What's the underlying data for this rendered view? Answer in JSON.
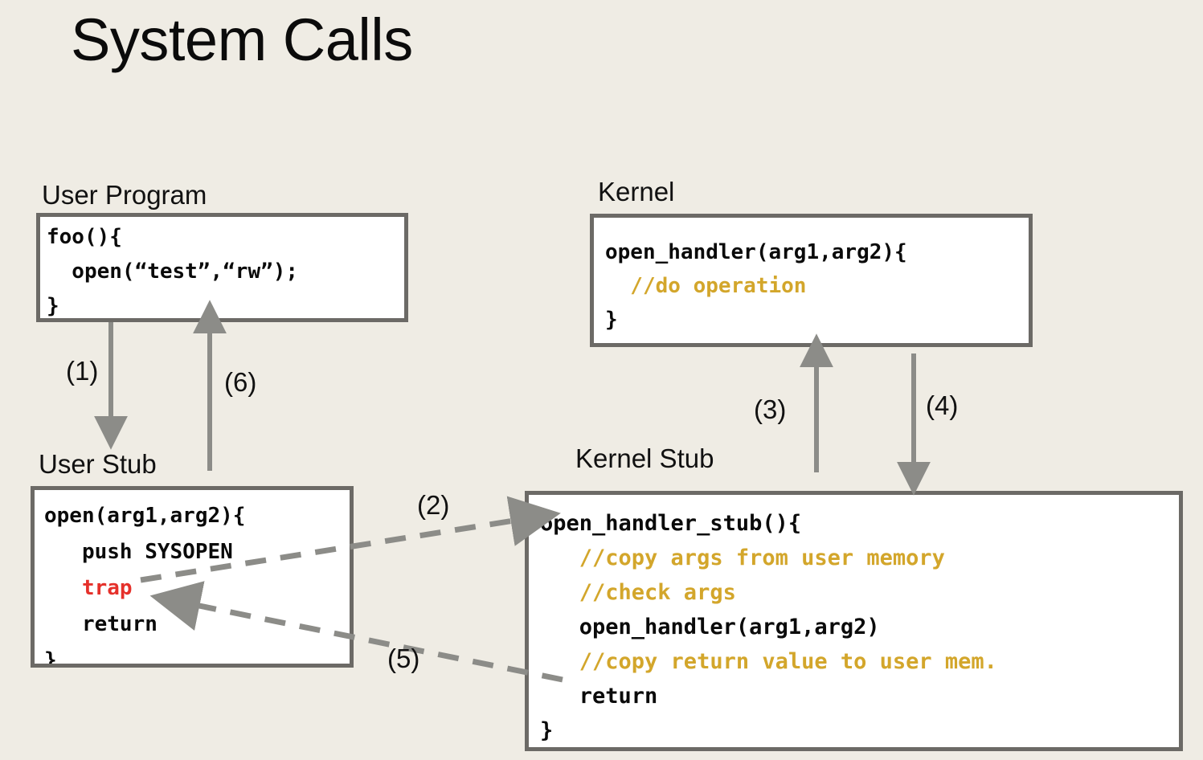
{
  "slide": {
    "title": "System Calls",
    "background_color": "#EFECE4"
  },
  "palette": {
    "background": "#EFECE4",
    "box_border": "#6C6A66",
    "box_fill": "#FFFFFF",
    "code_text": "#0A0A0A",
    "comment_gold": "#D3A62B",
    "trap_red": "#E5302A",
    "arrow_gray": "#8C8C88",
    "caption_text": "#111111"
  },
  "captions": {
    "user_program": "User Program",
    "kernel": "Kernel",
    "user_stub": "User Stub",
    "kernel_stub": "Kernel Stub"
  },
  "boxes": {
    "user_program": {
      "label": "User Program",
      "lines": [
        {
          "text": "foo(){",
          "style": "code"
        },
        {
          "text": "  open(“test”,“rw”);",
          "style": "code"
        },
        {
          "text": "}",
          "style": "code"
        }
      ]
    },
    "kernel": {
      "label": "Kernel",
      "lines": [
        {
          "text": "open_handler(arg1,arg2){",
          "style": "code"
        },
        {
          "text": "  //do operation",
          "style": "comment"
        },
        {
          "text": "}",
          "style": "code"
        }
      ]
    },
    "user_stub": {
      "label": "User Stub",
      "lines": [
        {
          "text": "open(arg1,arg2){",
          "style": "code"
        },
        {
          "text": "   push SYSOPEN",
          "style": "code"
        },
        {
          "text": "   trap",
          "style": "trap"
        },
        {
          "text": "   return",
          "style": "code"
        },
        {
          "text": "}",
          "style": "code"
        }
      ]
    },
    "kernel_stub": {
      "label": "Kernel Stub",
      "lines": [
        {
          "text": "open_handler_stub(){",
          "style": "code"
        },
        {
          "text": "   //copy args from user memory",
          "style": "comment"
        },
        {
          "text": "   //check args",
          "style": "comment"
        },
        {
          "text": "   open_handler(arg1,arg2)",
          "style": "code"
        },
        {
          "text": "   //copy return value to user mem.",
          "style": "comment"
        },
        {
          "text": "   return",
          "style": "code"
        },
        {
          "text": "}",
          "style": "code"
        }
      ]
    }
  },
  "steps": [
    {
      "id": "1",
      "label": "(1)",
      "from": "user-program",
      "to": "user-stub",
      "direction": "down",
      "style": "solid"
    },
    {
      "id": "2",
      "label": "(2)",
      "from": "user-stub",
      "to": "kernel-stub",
      "direction": "up-right",
      "style": "dashed"
    },
    {
      "id": "3",
      "label": "(3)",
      "from": "kernel-stub",
      "to": "kernel",
      "direction": "up",
      "style": "solid"
    },
    {
      "id": "4",
      "label": "(4)",
      "from": "kernel",
      "to": "kernel-stub",
      "direction": "down",
      "style": "solid"
    },
    {
      "id": "5",
      "label": "(5)",
      "from": "kernel-stub",
      "to": "user-stub",
      "direction": "down-left",
      "style": "dashed"
    },
    {
      "id": "6",
      "label": "(6)",
      "from": "user-stub",
      "to": "user-program",
      "direction": "up",
      "style": "solid"
    }
  ]
}
